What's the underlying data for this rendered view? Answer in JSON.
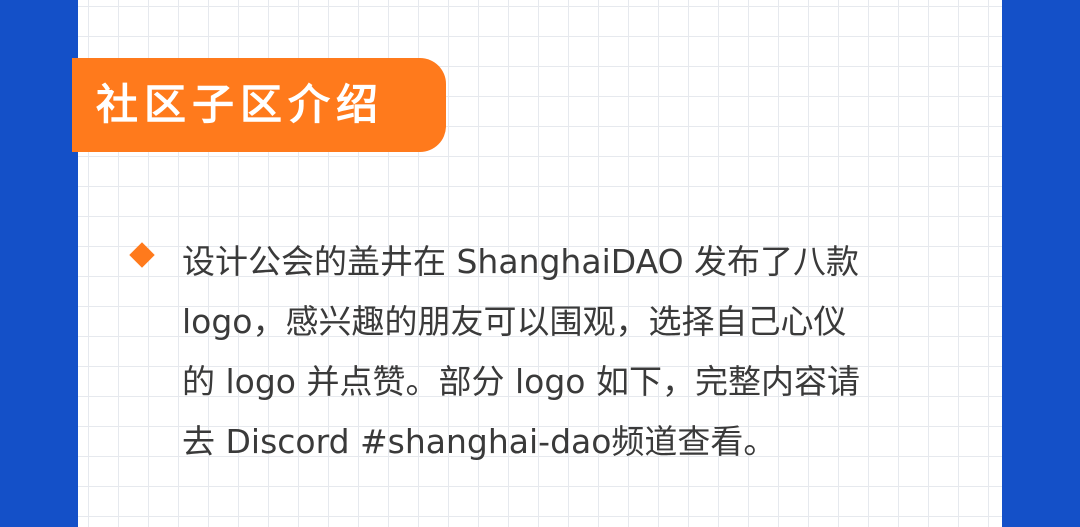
{
  "colors": {
    "frame_blue": "#1450c8",
    "accent_orange": "#ff7a1c",
    "grid_line": "#e6e9ee",
    "text": "#3a3a3a"
  },
  "section": {
    "title": "社区子区介绍"
  },
  "bullet": {
    "icon": "diamond-bullet-icon",
    "lines": [
      "设计公会的盖井在 ShanghaiDAO 发布了八款",
      "logo，感兴趣的朋友可以围观，选择自己心仪",
      "的 logo 并点赞。部分 logo 如下，完整内容请",
      "去 Discord #shanghai-dao频道查看。"
    ]
  }
}
